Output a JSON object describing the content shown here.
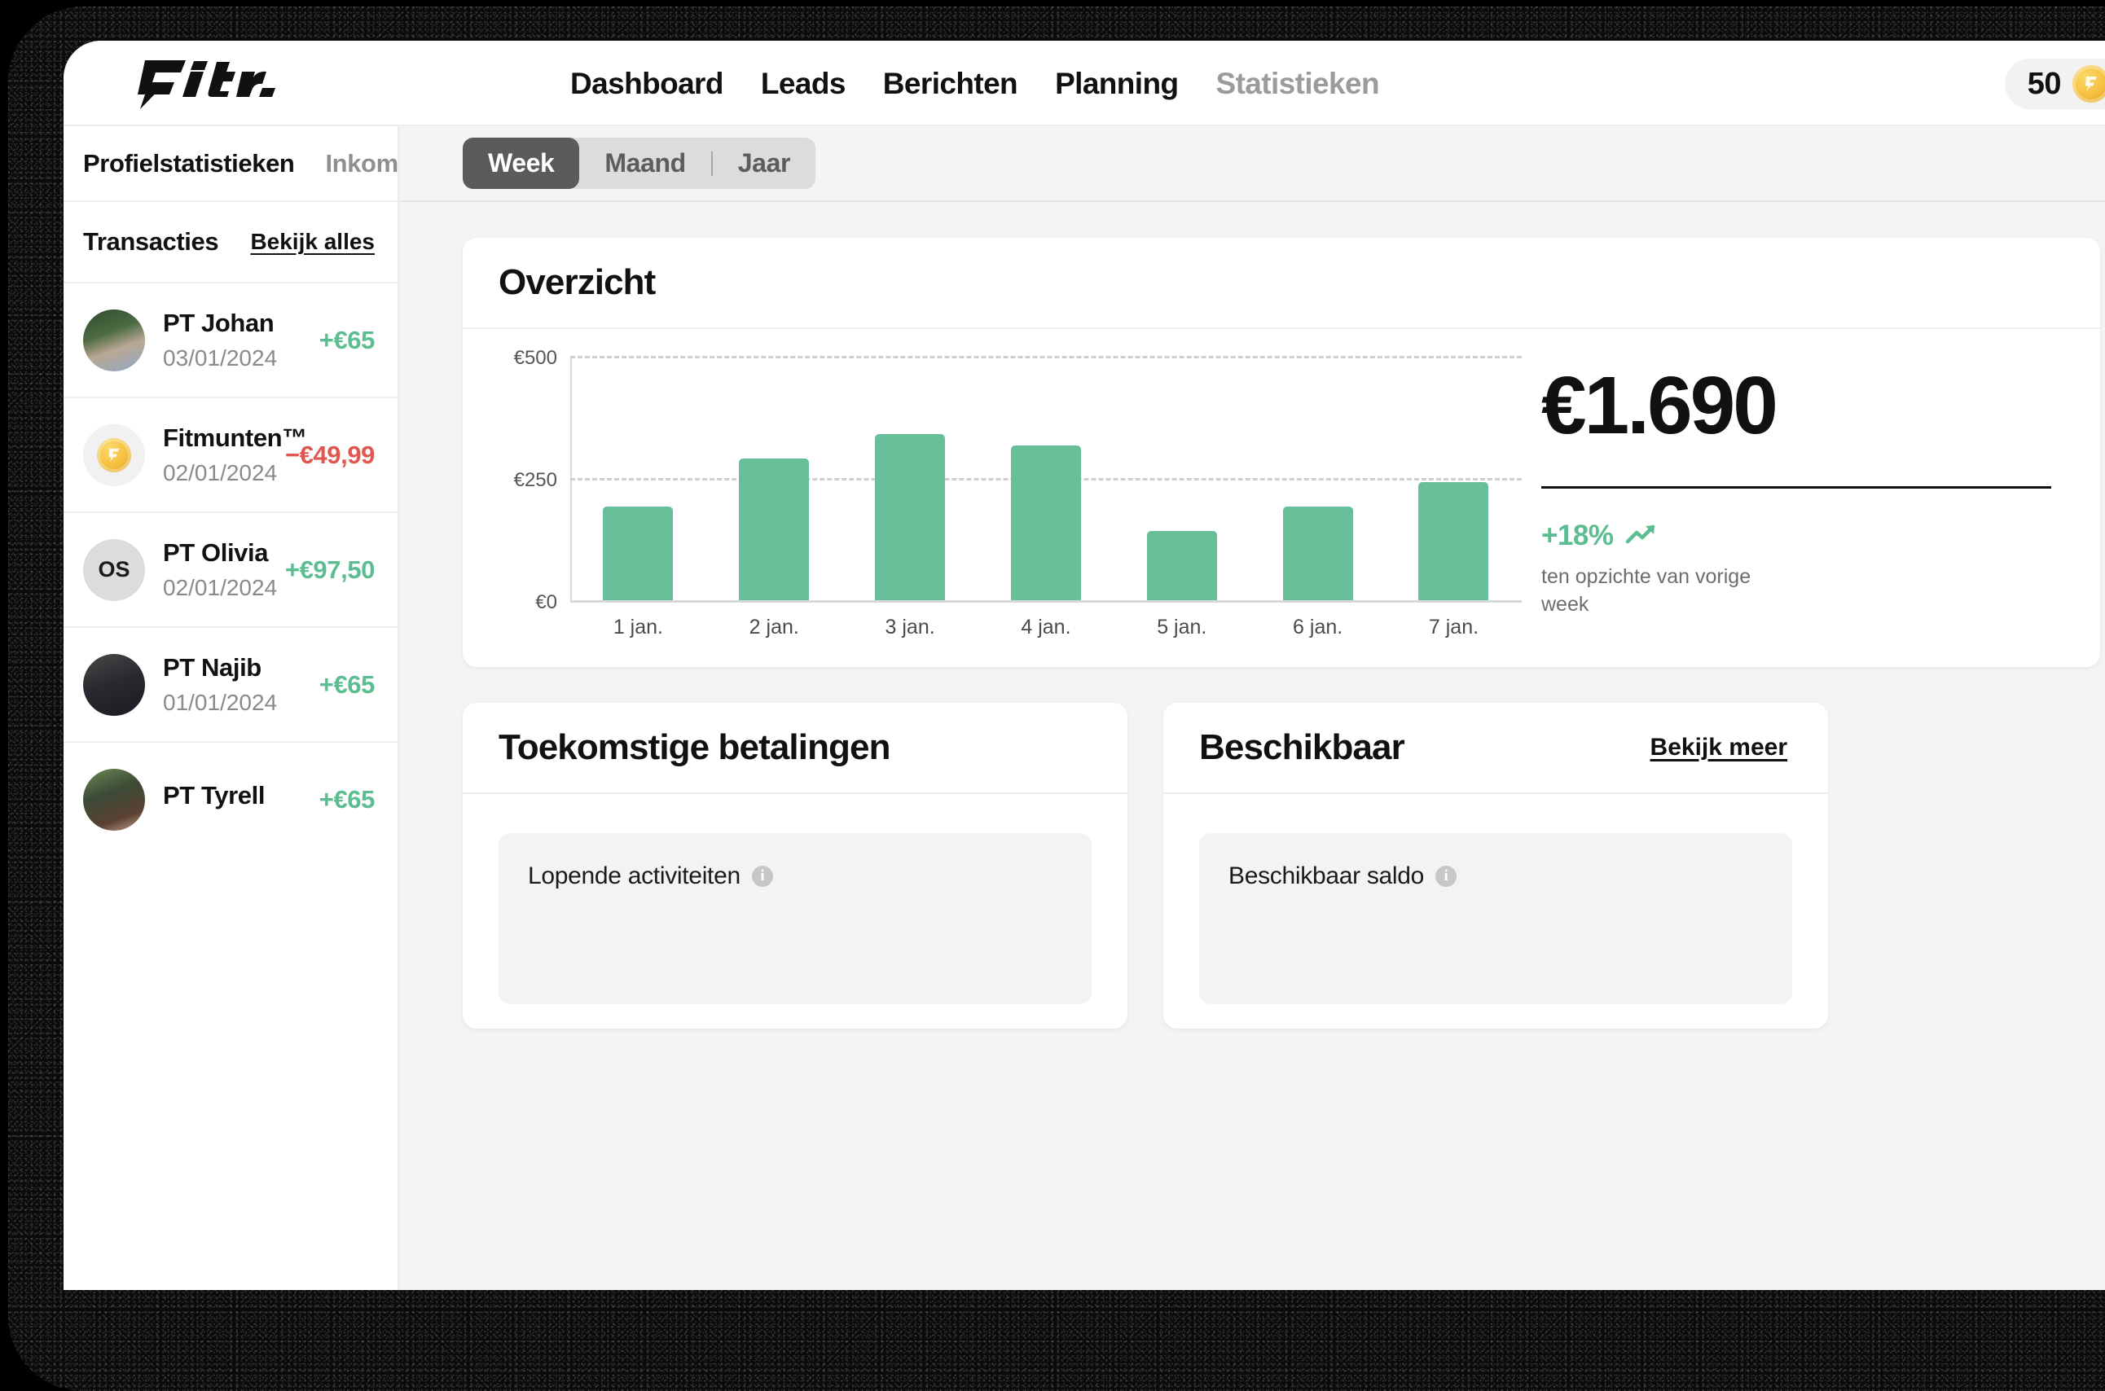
{
  "brand": {
    "logo_text": "fitr."
  },
  "nav": {
    "items": [
      {
        "label": "Dashboard",
        "active": true
      },
      {
        "label": "Leads",
        "active": true
      },
      {
        "label": "Berichten",
        "active": true
      },
      {
        "label": "Planning",
        "active": true
      },
      {
        "label": "Statistieken",
        "active": false
      }
    ]
  },
  "coins": {
    "count": "50",
    "icon": "fit-coin-icon"
  },
  "sidebar": {
    "tabs": [
      {
        "label": "Profielstatistieken",
        "active": true
      },
      {
        "label": "Inkomsten",
        "active": false
      }
    ],
    "transactions_title": "Transacties",
    "view_all_label": "Bekijk alles",
    "transactions": [
      {
        "name": "PT Johan",
        "date": "03/01/2024",
        "amount": "+€65",
        "sign": "pos",
        "avatar_type": "photo",
        "initials": ""
      },
      {
        "name": "Fitmunten™",
        "date": "02/01/2024",
        "amount": "−€49,99",
        "sign": "neg",
        "avatar_type": "coin",
        "initials": ""
      },
      {
        "name": "PT Olivia",
        "date": "02/01/2024",
        "amount": "+€97,50",
        "sign": "pos",
        "avatar_type": "initials",
        "initials": "OS"
      },
      {
        "name": "PT Najib",
        "date": "01/01/2024",
        "amount": "+€65",
        "sign": "pos",
        "avatar_type": "photo",
        "initials": ""
      },
      {
        "name": "PT Tyrell",
        "date": "",
        "amount": "+€65",
        "sign": "pos",
        "avatar_type": "photo",
        "initials": ""
      }
    ]
  },
  "period": {
    "options": [
      {
        "label": "Week",
        "active": true
      },
      {
        "label": "Maand",
        "active": false
      },
      {
        "label": "Jaar",
        "active": false
      }
    ]
  },
  "overview": {
    "title": "Overzicht",
    "total": "€1.690",
    "delta": "+18%",
    "delta_icon": "trend-up-icon",
    "note": "ten opzichte van vorige week"
  },
  "future_payments": {
    "title": "Toekomstige betalingen",
    "tile_label": "Lopende activiteiten",
    "info_icon": "info-icon"
  },
  "available": {
    "title": "Beschikbaar",
    "link_label": "Bekijk meer",
    "tile_label": "Beschikbaar saldo",
    "info_icon": "info-icon"
  },
  "colors": {
    "bar_green": "#66bf99",
    "positive": "#5cbd91",
    "negative": "#e0574f",
    "coin_gold": "#f4bf3f",
    "active_pill": "#5b5b5b"
  },
  "chart_data": {
    "type": "bar",
    "title": "Overzicht",
    "xlabel": "",
    "ylabel": "",
    "categories": [
      "1 jan.",
      "2 jan.",
      "3 jan.",
      "4 jan.",
      "5 jan.",
      "6 jan.",
      "7 jan."
    ],
    "values": [
      192,
      290,
      340,
      316,
      141,
      192,
      241
    ],
    "ylim": [
      0,
      500
    ],
    "yticks": [
      0,
      250,
      500
    ],
    "ytick_labels": [
      "€0",
      "€250",
      "€500"
    ],
    "grid": true,
    "legend": "none",
    "series_color": "#66bf99",
    "total_label": "€1.690",
    "delta_label": "+18%"
  }
}
